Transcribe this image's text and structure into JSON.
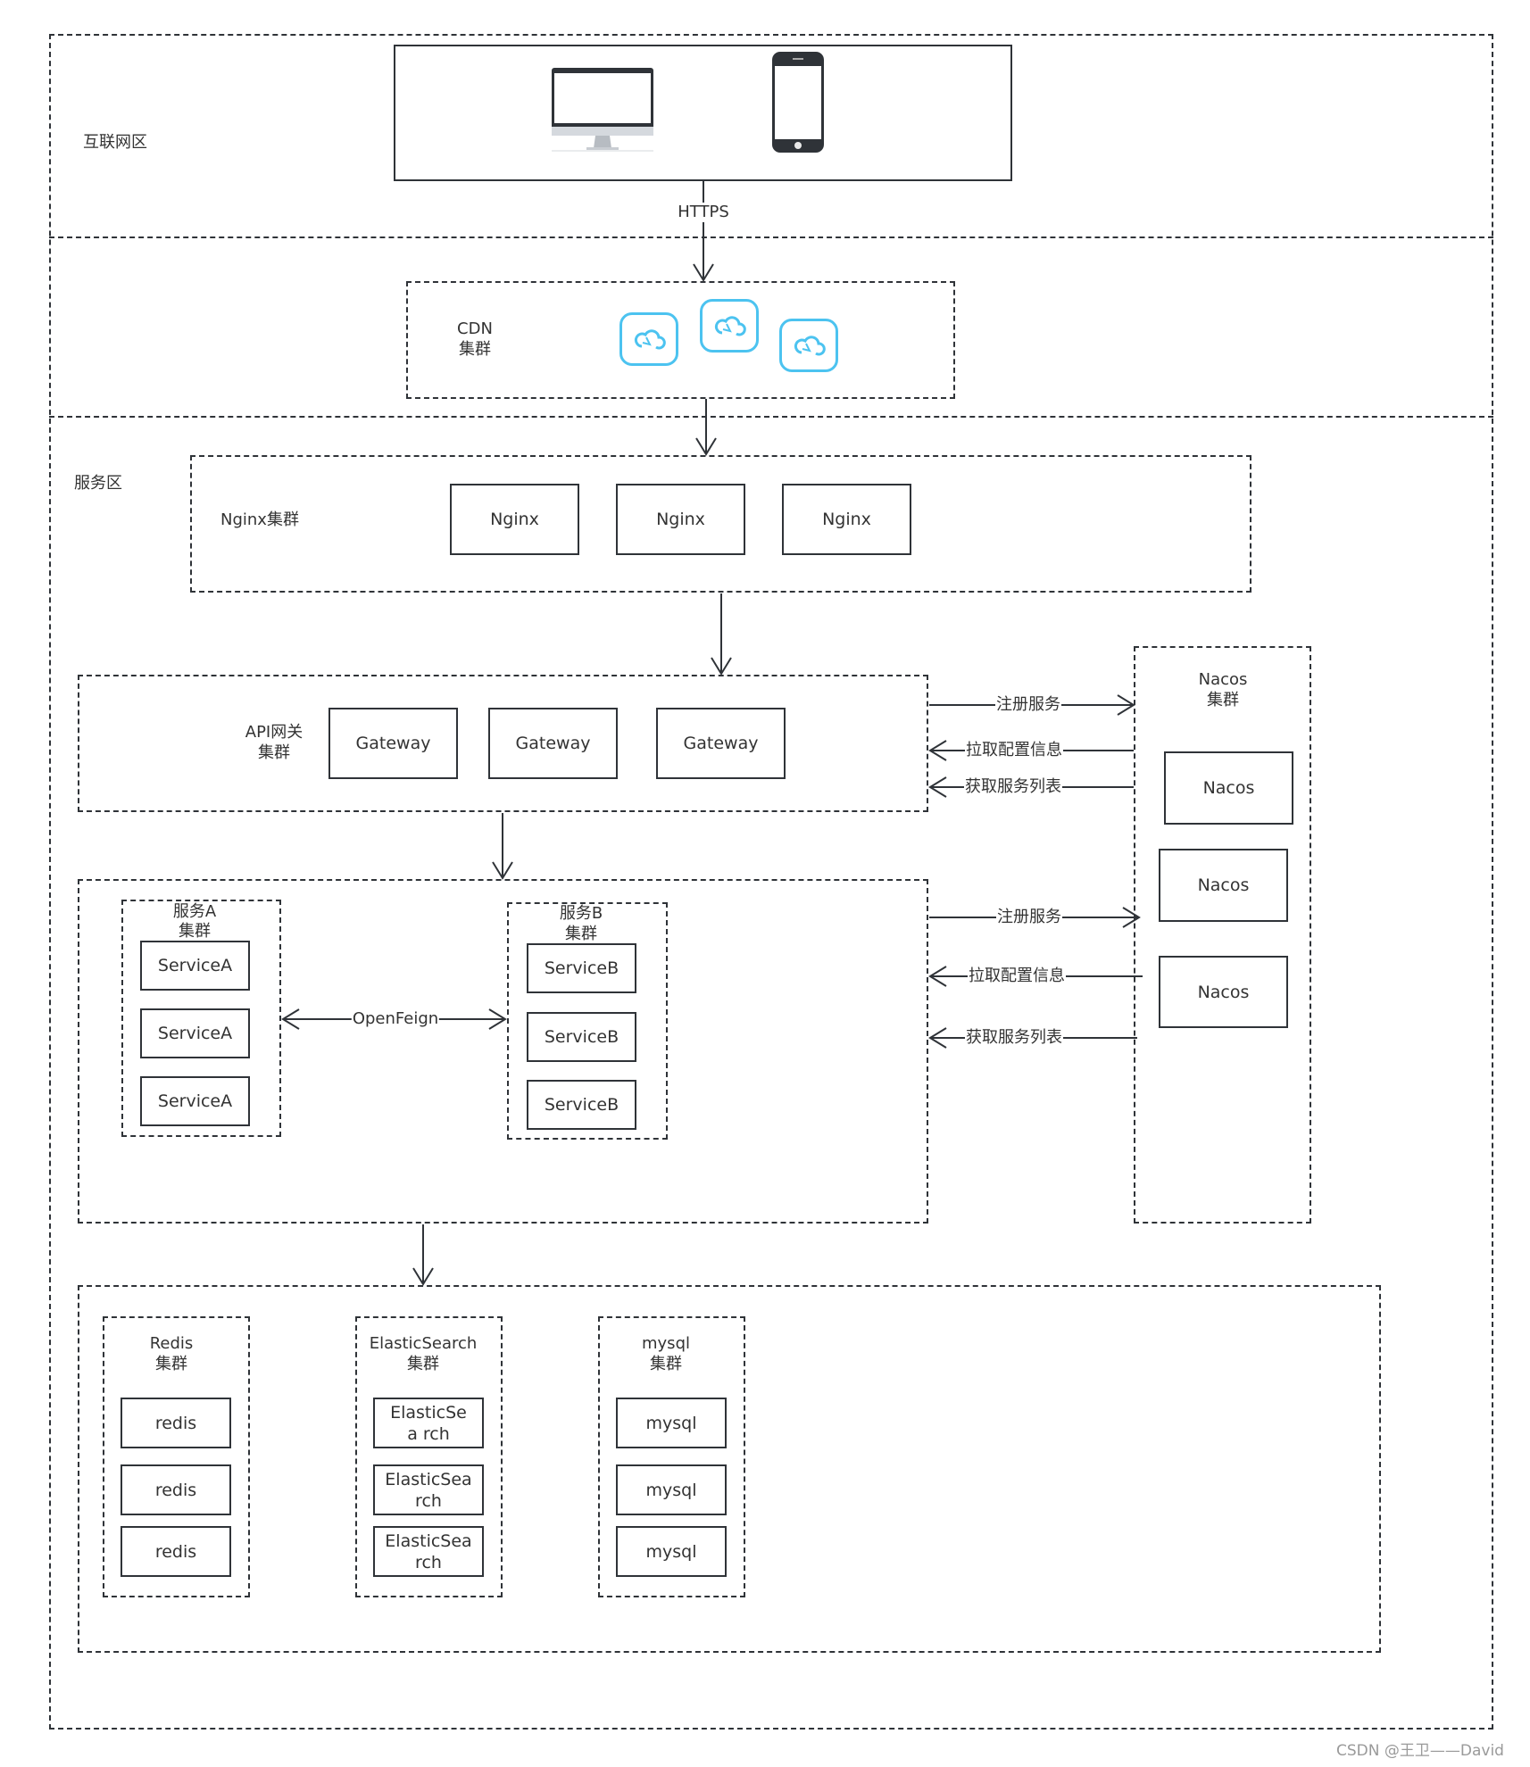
{
  "zones": {
    "internet": "互联网区",
    "service": "服务区"
  },
  "clients": {
    "desktop_icon": "desktop-monitor-icon",
    "mobile_icon": "mobile-phone-icon"
  },
  "edges": {
    "https": "HTTPS",
    "openfeign": "OpenFeign",
    "register": "注册服务",
    "pull_config": "拉取配置信息",
    "get_service_list": "获取服务列表"
  },
  "cdn": {
    "title": "CDN",
    "subtitle": "集群",
    "icon": "cdn-cloud-icon",
    "accent_color": "#4cc3f0"
  },
  "nginx": {
    "title": "Nginx集群",
    "nodes": [
      "Nginx",
      "Nginx",
      "Nginx"
    ]
  },
  "gateway": {
    "title": "API网关",
    "subtitle": "集群",
    "nodes": [
      "Gateway",
      "Gateway",
      "Gateway"
    ]
  },
  "nacos": {
    "title": "Nacos",
    "subtitle": "集群",
    "nodes": [
      "Nacos",
      "Nacos",
      "Nacos"
    ]
  },
  "service_a": {
    "title": "服务A",
    "subtitle": "集群",
    "nodes": [
      "ServiceA",
      "ServiceA",
      "ServiceA"
    ]
  },
  "service_b": {
    "title": "服务B",
    "subtitle": "集群",
    "nodes": [
      "ServiceB",
      "ServiceB",
      "ServiceB"
    ]
  },
  "redis": {
    "title": "Redis",
    "subtitle": "集群",
    "nodes": [
      "redis",
      "redis",
      "redis"
    ]
  },
  "elasticsearch": {
    "title": "ElasticSearch",
    "subtitle": "集群",
    "nodes": [
      "ElasticSea rch",
      "ElasticSea rch",
      "ElasticSea rch"
    ]
  },
  "mysql": {
    "title": "mysql",
    "subtitle": "集群",
    "nodes": [
      "mysql",
      "mysql",
      "mysql"
    ]
  },
  "watermark": "CSDN @王卫——David"
}
